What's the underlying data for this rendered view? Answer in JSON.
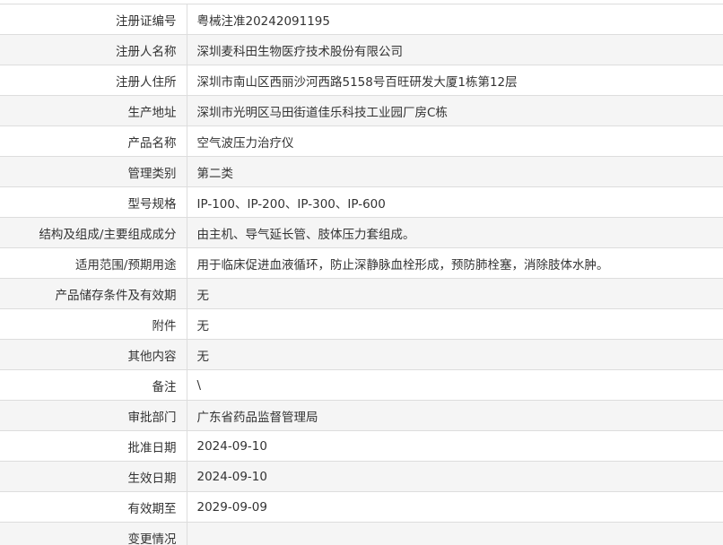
{
  "record": {
    "rows": [
      {
        "label": "注册证编号",
        "value": "粤械注准20242091195"
      },
      {
        "label": "注册人名称",
        "value": "深圳麦科田生物医疗技术股份有限公司"
      },
      {
        "label": "注册人住所",
        "value": "深圳市南山区西丽沙河西路5158号百旺研发大厦1栋第12层"
      },
      {
        "label": "生产地址",
        "value": "深圳市光明区马田街道佳乐科技工业园厂房C栋"
      },
      {
        "label": "产品名称",
        "value": "空气波压力治疗仪"
      },
      {
        "label": "管理类别",
        "value": "第二类"
      },
      {
        "label": "型号规格",
        "value": "IP-100、IP-200、IP-300、IP-600"
      },
      {
        "label": "结构及组成/主要组成成分",
        "value": "由主机、导气延长管、肢体压力套组成。"
      },
      {
        "label": "适用范围/预期用途",
        "value": "用于临床促进血液循环，防止深静脉血栓形成，预防肺栓塞，消除肢体水肿。"
      },
      {
        "label": "产品储存条件及有效期",
        "value": "无"
      },
      {
        "label": "附件",
        "value": "无"
      },
      {
        "label": "其他内容",
        "value": "无"
      },
      {
        "label": "备注",
        "value": "\\"
      },
      {
        "label": "审批部门",
        "value": "广东省药品监督管理局"
      },
      {
        "label": "批准日期",
        "value": "2024-09-10"
      },
      {
        "label": "生效日期",
        "value": "2024-09-10"
      },
      {
        "label": "有效期至",
        "value": "2029-09-09"
      },
      {
        "label": "变更情况",
        "value": ""
      }
    ]
  }
}
